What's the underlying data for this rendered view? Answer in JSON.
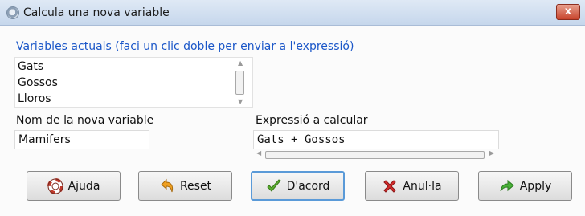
{
  "window": {
    "title": "Calcula una nova variable",
    "close_label": "x"
  },
  "variables": {
    "label": "Variables actuals (faci un clic doble per enviar a l'expressió)",
    "items": [
      "Gats",
      "Gossos",
      "Lloros"
    ]
  },
  "new_variable": {
    "label": "Nom de la nova variable",
    "value": "Mamifers"
  },
  "expression": {
    "label": "Expressió a calcular",
    "value": "Gats + Gossos"
  },
  "buttons": {
    "help": "Ajuda",
    "reset": "Reset",
    "ok": "D'acord",
    "cancel": "Anul·la",
    "apply": "Apply"
  },
  "icons": {
    "app": "r-logo-icon",
    "help": "lifebuoy-icon",
    "reset": "undo-arrow-icon",
    "ok": "checkmark-icon",
    "cancel": "red-x-icon",
    "apply": "green-arrow-icon"
  },
  "colors": {
    "label_blue": "#1a56c8",
    "close_red": "#c8442c"
  }
}
